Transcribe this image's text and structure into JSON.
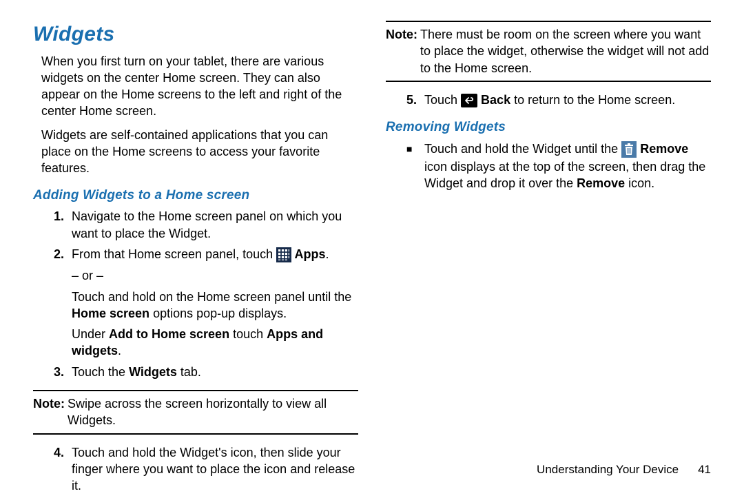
{
  "heading": "Widgets",
  "intro_p1": "When you first turn on your tablet, there are various widgets on the center Home screen. They can also appear on the Home screens to the left and right of the center Home screen.",
  "intro_p2": "Widgets are self-contained applications that you can place on the Home screens to access your favorite features.",
  "sub1": "Adding Widgets to a Home screen",
  "step1_num": "1.",
  "step1": "Navigate to the Home screen panel on which you want to place the Widget.",
  "step2_num": "2.",
  "step2_a": "From that Home screen panel, touch ",
  "step2_apps": " Apps",
  "step2_end": ".",
  "or": "– or –",
  "step2_b1": "Touch and hold on the Home screen panel until the ",
  "step2_b_bold": "Home screen",
  "step2_b2": " options pop-up displays.",
  "step2_c1": "Under ",
  "step2_c_b1": "Add to Home screen",
  "step2_c2": " touch ",
  "step2_c_b2": "Apps and widgets",
  "step2_c3": ".",
  "step3_num": "3.",
  "step3_a": "Touch the ",
  "step3_b": "Widgets",
  "step3_c": " tab.",
  "note1_label": "Note:",
  "note1": "Swipe across the screen horizontally to view all Widgets.",
  "step4_num": "4.",
  "step4": "Touch and hold the Widget's icon, then slide your finger where you want to place the icon and release it.",
  "note2_label": "Note:",
  "note2": "There must be room on the screen where you want to place the widget, otherwise the widget will not add to the Home screen.",
  "step5_num": "5.",
  "step5_a": "Touch ",
  "step5_b": " Back",
  "step5_c": " to return to the Home screen.",
  "sub2": "Removing Widgets",
  "rem_a": "Touch and hold the Widget until the ",
  "rem_b": " Remove",
  "rem_c": " icon displays at the top of the screen, then drag the Widget and drop it over the ",
  "rem_d": "Remove",
  "rem_e": " icon.",
  "footer_section": "Understanding Your Device",
  "footer_page": "41"
}
